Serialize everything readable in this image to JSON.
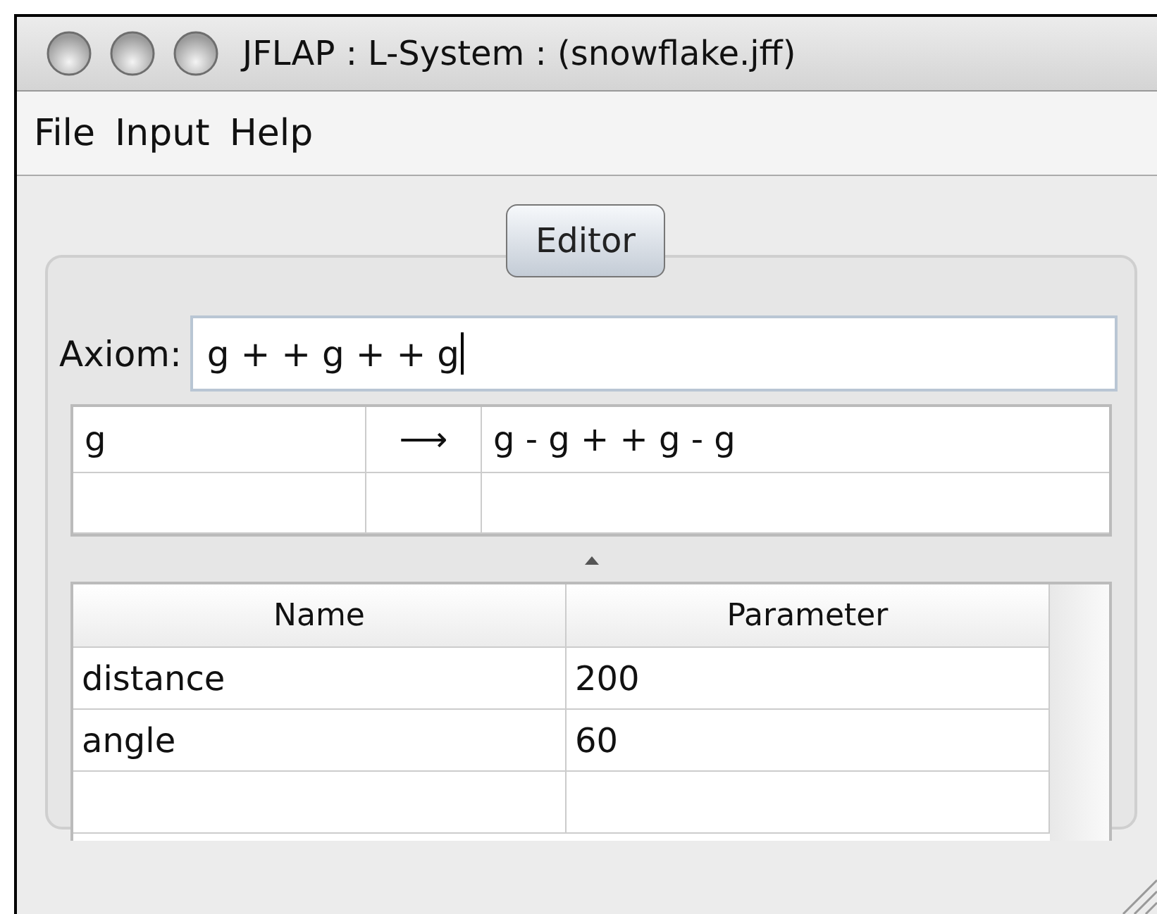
{
  "window": {
    "title": "JFLAP : L-System : (snowflake.jff)"
  },
  "menu": [
    "File",
    "Input",
    "Help"
  ],
  "tabs": [
    {
      "label": "Editor",
      "selected": true
    }
  ],
  "axiom": {
    "label": "Axiom:",
    "value": "g + + g + + g",
    "focused": true
  },
  "rules": [
    {
      "left": "g",
      "arrow": "⟶",
      "right": "g - g + + g - g"
    }
  ],
  "parameters": {
    "columns": [
      "Name",
      "Parameter"
    ],
    "rows": [
      {
        "name": "distance",
        "value": "200"
      },
      {
        "name": "angle",
        "value": "60"
      }
    ]
  }
}
